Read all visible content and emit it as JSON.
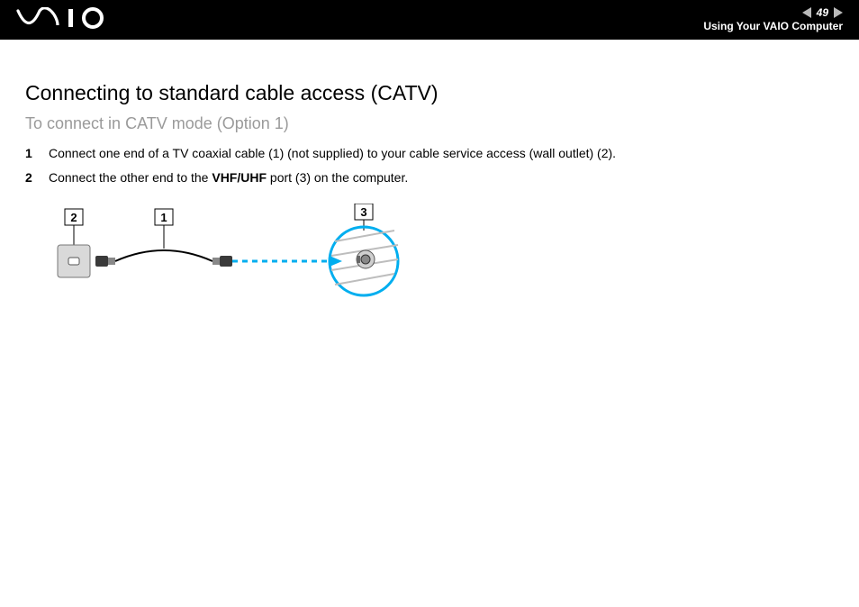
{
  "header": {
    "page_number": "49",
    "section": "Using Your VAIO Computer",
    "logo_alt": "VAIO"
  },
  "title": "Connecting to standard cable access (CATV)",
  "subtitle": "To connect in CATV mode (Option 1)",
  "steps": [
    {
      "num": "1",
      "text_pre": "Connect one end of a TV coaxial cable (1) (not supplied) to your cable service access (wall outlet) (2).",
      "bold": "",
      "text_post": ""
    },
    {
      "num": "2",
      "text_pre": "Connect the other end to the ",
      "bold": "VHF/UHF",
      "text_post": " port (3) on the computer."
    }
  ],
  "diagram": {
    "labels": {
      "wall_outlet": "2",
      "cable": "1",
      "port": "3"
    }
  }
}
